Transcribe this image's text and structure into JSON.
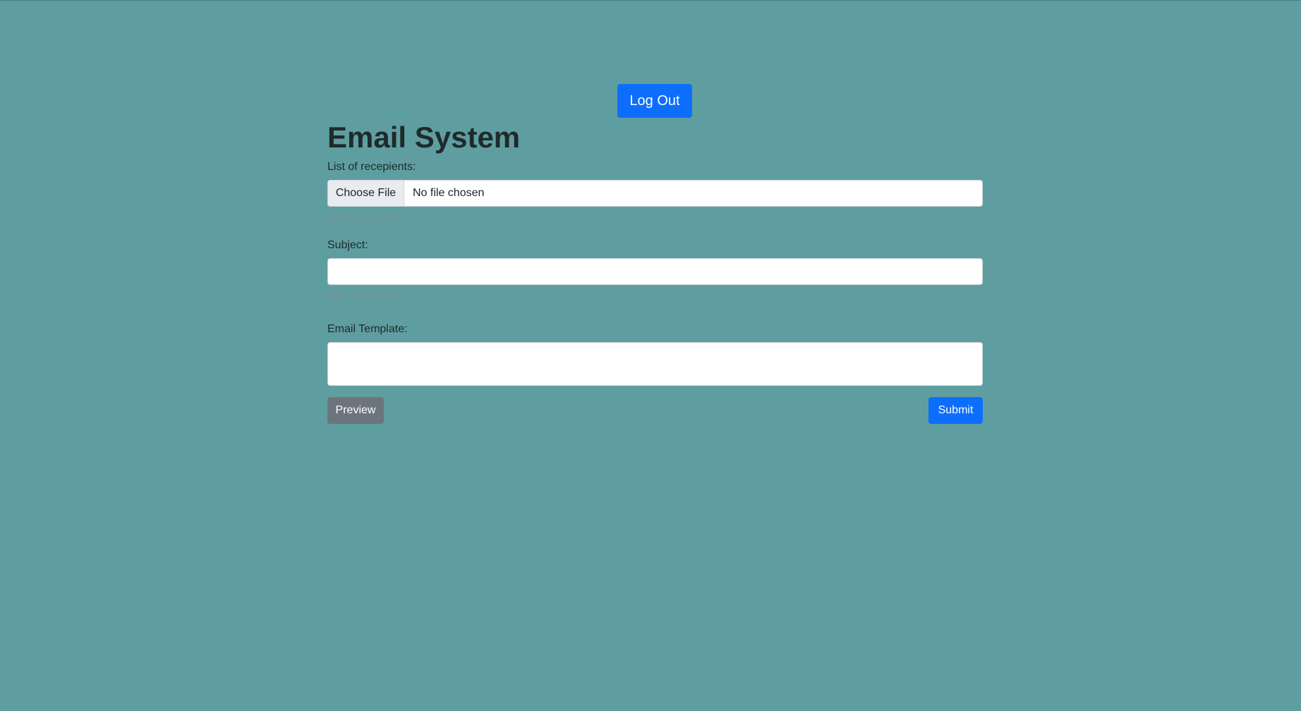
{
  "header": {
    "logout_label": "Log Out"
  },
  "form": {
    "title": "Email System",
    "recipients": {
      "label": "List of recepients:",
      "choose_file_label": "Choose File",
      "file_status": "No file chosen",
      "helper": "Upload a .csv file"
    },
    "subject": {
      "label": "Subject:",
      "value": "",
      "helper": "Max 70 characters"
    },
    "template": {
      "label": "Email Template:",
      "value": ""
    },
    "preview_label": "Preview",
    "submit_label": "Submit"
  },
  "colors": {
    "background": "#5f9ea0",
    "primary": "#0d6efd",
    "secondary": "#6c757d"
  }
}
